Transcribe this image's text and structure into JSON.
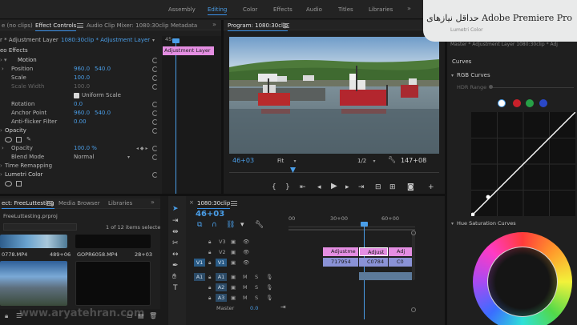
{
  "workspaces": {
    "items": [
      "Assembly",
      "Editing",
      "Color",
      "Effects",
      "Audio",
      "Titles",
      "Libraries"
    ],
    "active": "Editing"
  },
  "promo_banner": {
    "text": "حداقل نیازهای Adobe Premiere Pro"
  },
  "effect_controls": {
    "tabs": [
      "e (no clips)",
      "Effect Controls",
      "Audio Clip Mixer: 1080:30clip",
      "Metadata"
    ],
    "active_tab": "Effect Controls",
    "source_line": "r * Adjustment Layer",
    "seq_line": "1080:30clip * Adjustment Layer",
    "mini_timecode": "45",
    "clip_label": "Adjustment Layer",
    "video_effects_label": "eo Effects",
    "motion": "Motion",
    "position_label": "Position",
    "position_x": "960.0",
    "position_y": "540.0",
    "scale_label": "Scale",
    "scale_value": "100.0",
    "scale_width_label": "Scale Width",
    "scale_width_value": "100.0",
    "uniform_scale": "Uniform Scale",
    "rotation_label": "Rotation",
    "rotation_value": "0.0",
    "anchor_label": "Anchor Point",
    "anchor_x": "960.0",
    "anchor_y": "540.0",
    "antiflicker_label": "Anti-flicker Filter",
    "antiflicker_value": "0.00",
    "opacity_header": "Opacity",
    "opacity_label": "Opacity",
    "opacity_value": "100.0 %",
    "blend_label": "Blend Mode",
    "blend_value": "Normal",
    "time_remap": "Time Remapping",
    "lumetri": "Lumetri Color"
  },
  "program": {
    "title": "Program: 1080:30clip",
    "timecode_left": "46+03",
    "fit": "Fit",
    "ratio": "1/2",
    "timecode_right": "147+08"
  },
  "lumetri_panel": {
    "master_line": "Master * Adjustment Layer  1080:30clip * Adj",
    "curves": "Curves",
    "rgb_curves": "RGB Curves",
    "hdr_range": "HDR Range",
    "hue_sat": "Hue Saturation Curves",
    "colors": {
      "white": "#ffffff",
      "red": "#c8202a",
      "green": "#27a047",
      "blue": "#2a48c8"
    }
  },
  "project": {
    "tabs": [
      "ect: FreeLuttesting",
      "Media Browser",
      "Libraries"
    ],
    "active_tab": "ect: FreeLuttesting",
    "project_file": "FreeLuttesting.prproj",
    "items_count": "1 of 12 items selected",
    "clips": [
      {
        "name": "0778.MP4",
        "duration": "489+06"
      },
      {
        "name": "GOPR6058.MP4",
        "duration": "28+03"
      }
    ]
  },
  "timeline": {
    "tab": "1080:30clip",
    "timecode": "46+03",
    "ruler": [
      "00",
      "30+00",
      "60+00"
    ],
    "tracks": {
      "v3": "V3",
      "v2": "V2",
      "v1": "V1",
      "v1src": "V1",
      "a1": "A1",
      "a2": "A2",
      "a3": "A3",
      "a1src": "A1",
      "master": "Master",
      "master_value": "0.0"
    },
    "clips": {
      "adj1": "Adjustme",
      "adj2": "Adjust",
      "adj3": "Adj",
      "clipA": "717954",
      "clipB": "C0784",
      "clipC": "C0"
    }
  },
  "watermark": "www.aryatehran.com"
}
